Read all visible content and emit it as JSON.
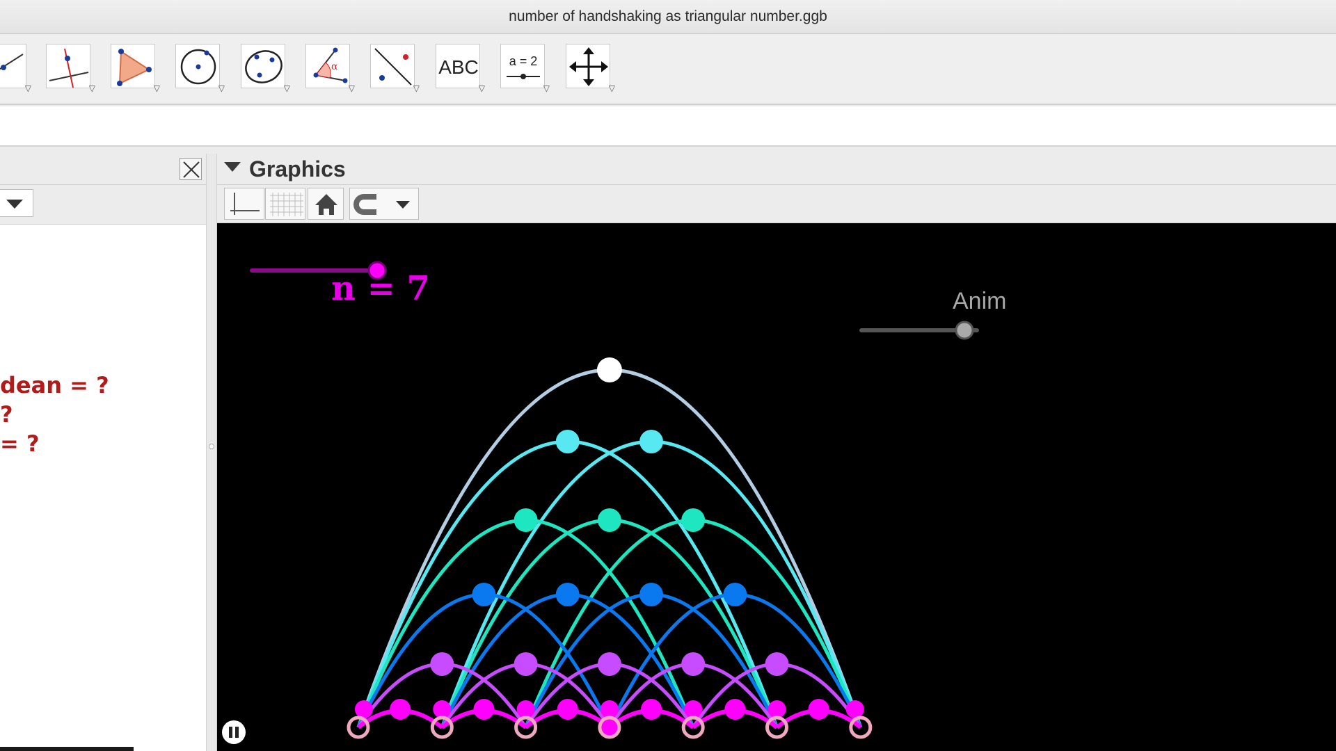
{
  "window": {
    "title": "number of handshaking as triangular number.ggb"
  },
  "toolbar": {
    "tools": [
      {
        "name": "line-tool-icon"
      },
      {
        "name": "perpendicular-line-tool-icon"
      },
      {
        "name": "polygon-tool-icon"
      },
      {
        "name": "circle-tool-icon"
      },
      {
        "name": "conic-tool-icon"
      },
      {
        "name": "angle-tool-icon"
      },
      {
        "name": "reflect-tool-icon"
      },
      {
        "name": "text-tool-icon",
        "label": "ABC"
      },
      {
        "name": "slider-tool-icon",
        "label": "a = 2"
      },
      {
        "name": "move-graphics-view-tool-icon"
      }
    ]
  },
  "algebra": {
    "lines": [
      "dean = ?",
      "?",
      "= ?"
    ],
    "color": "#b31b1b"
  },
  "graphics": {
    "title": "Graphics",
    "slider_n": {
      "label": "n = 7",
      "value": 7,
      "fraction": 1.0,
      "color": "#e800e8"
    },
    "slider_anim": {
      "label": "Anim",
      "fraction": 0.87
    },
    "layer_colors": [
      "#ff00ff",
      "#c84cff",
      "#0a78ee",
      "#1ee6c0",
      "#58e8f2",
      "#b3cde3",
      "#ffffff"
    ],
    "base_ring_color": "#f0a8c0",
    "pause_icon": "pause-icon"
  }
}
